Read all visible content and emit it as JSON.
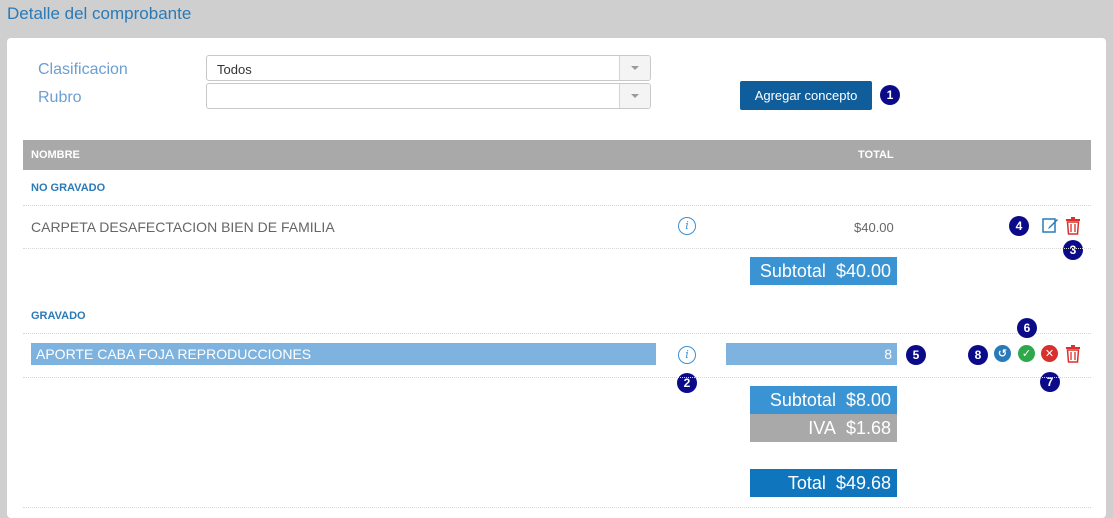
{
  "page": {
    "title": "Detalle del comprobante"
  },
  "filters": {
    "clasificacion_label": "Clasificacion",
    "clasificacion_value": "Todos",
    "rubro_label": "Rubro",
    "rubro_value": ""
  },
  "toolbar": {
    "add_label": "Agregar concepto"
  },
  "table": {
    "col_nombre": "NOMBRE",
    "col_total": "TOTAL"
  },
  "sections": {
    "no_gravado": {
      "title": "NO GRAVADO",
      "row": {
        "name": "CARPETA DESAFECTACION BIEN DE FAMILIA",
        "total": "$40.00"
      },
      "subtotal_label": "Subtotal",
      "subtotal_value": "$40.00"
    },
    "gravado": {
      "title": "GRAVADO",
      "row": {
        "name": "APORTE CABA FOJA REPRODUCCIONES",
        "total": "8"
      },
      "subtotal_label": "Subtotal",
      "subtotal_value": "$8.00",
      "iva_label": "IVA",
      "iva_value": "$1.68"
    }
  },
  "totals": {
    "label": "Total",
    "value": "$49.68"
  },
  "badges": {
    "b1": "1",
    "b2": "2",
    "b3": "3",
    "b4": "4",
    "b5": "5",
    "b6": "6",
    "b7": "7",
    "b8": "8"
  },
  "colors": {
    "accent": "#0f5d9b",
    "badge": "#0b0b8a",
    "delete": "#d9302c",
    "confirm": "#2ea84a"
  }
}
